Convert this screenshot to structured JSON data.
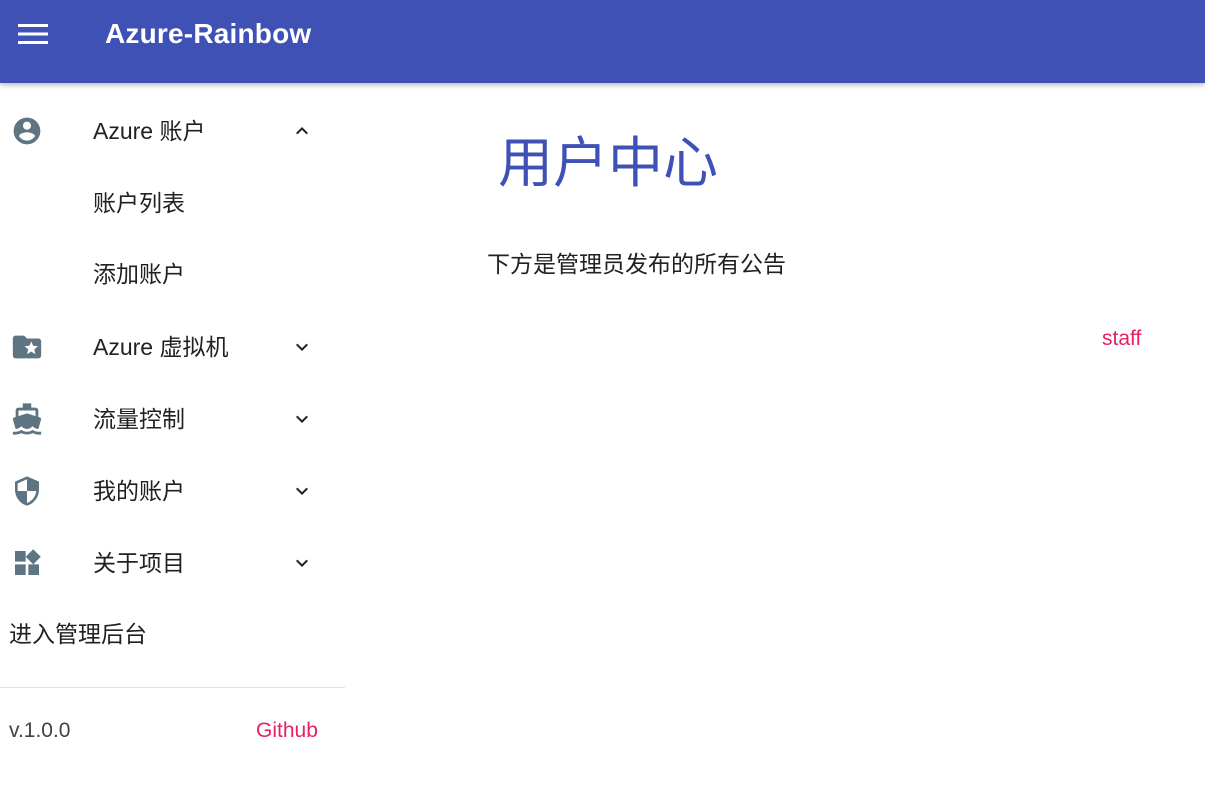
{
  "app": {
    "title": "Azure-Rainbow",
    "colors": {
      "primary": "#3f51b5",
      "accent": "#e91e63",
      "icon": "#5f7482"
    }
  },
  "header": {
    "menu_icon": "menu-icon"
  },
  "sidebar": {
    "groups": [
      {
        "label": "Azure 账户",
        "icon": "account-circle-icon",
        "expanded": true,
        "chevron": "chevron-up-icon",
        "children": [
          "账户列表",
          "添加账户"
        ]
      },
      {
        "label": "Azure 虚拟机",
        "icon": "folder-star-icon",
        "expanded": false,
        "chevron": "chevron-down-icon"
      },
      {
        "label": "流量控制",
        "icon": "ferry-icon",
        "expanded": false,
        "chevron": "chevron-down-icon"
      },
      {
        "label": "我的账户",
        "icon": "shield-icon",
        "expanded": false,
        "chevron": "chevron-down-icon"
      },
      {
        "label": "关于项目",
        "icon": "widgets-icon",
        "expanded": false,
        "chevron": "chevron-down-icon"
      }
    ],
    "admin_link": "进入管理后台",
    "footer": {
      "version": "v.1.0.0",
      "github": "Github"
    }
  },
  "main": {
    "title": "用户中心",
    "subtitle": "下方是管理员发布的所有公告",
    "announcement_author": "staff"
  }
}
